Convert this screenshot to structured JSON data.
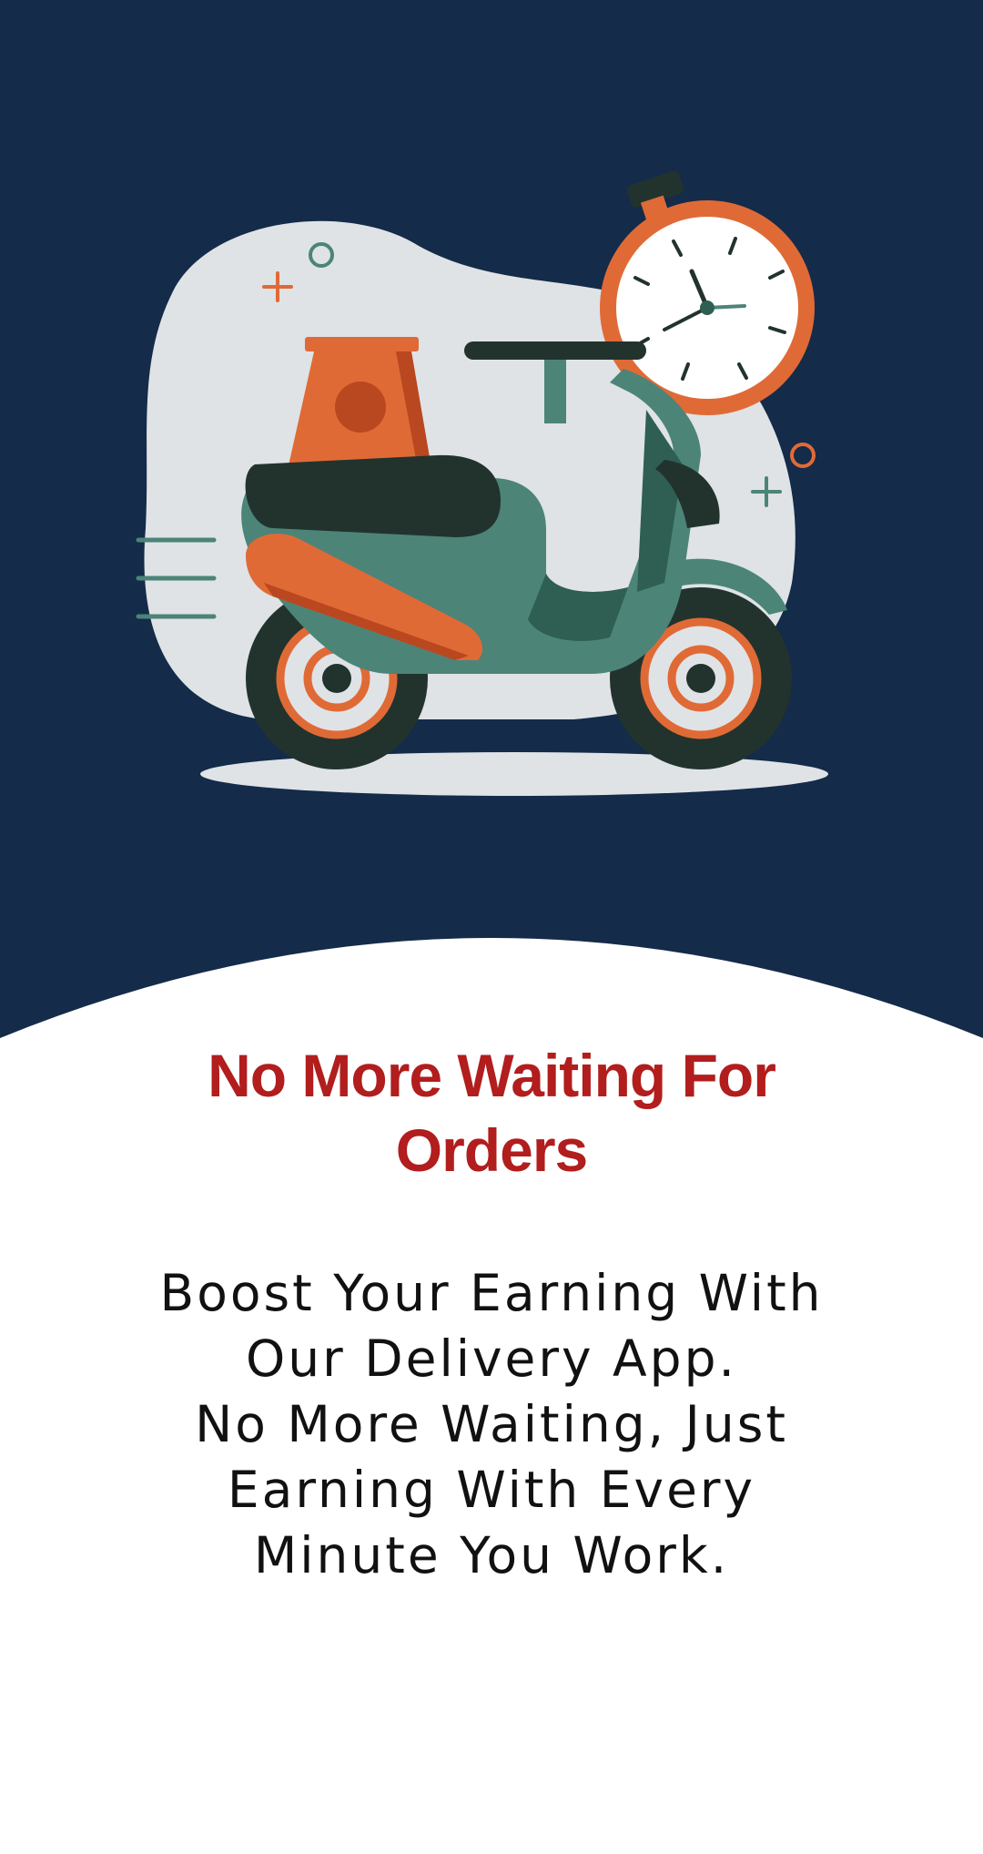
{
  "colors": {
    "navy": "#142b4a",
    "blob": "#dfe3e6",
    "orange": "#e06a36",
    "dark_orange": "#b9471f",
    "teal": "#4c8478",
    "dark_teal": "#2f5e53",
    "near_black": "#22332d",
    "headline": "#b21d1d",
    "body_text": "#111111"
  },
  "onboarding": {
    "illustration": "delivery-scooter-with-stopwatch",
    "headline": "No More Waiting For Orders",
    "body": "Boost Your Earning With\nOur Delivery App.\nNo More Waiting, Just\nEarning With Every\nMinute You Work."
  }
}
